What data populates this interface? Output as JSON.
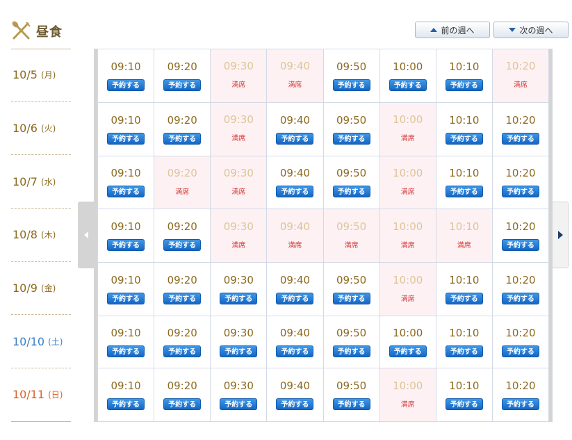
{
  "header": {
    "title": "昼食",
    "icon": "utensils-icon"
  },
  "nav": {
    "prev_label": "前の週へ",
    "next_label": "次の週へ"
  },
  "labels": {
    "reserve": "予約する",
    "full": "満席"
  },
  "colors": {
    "weekday": "#8b6a1f",
    "saturday": "#3b82c4",
    "sunday": "#d9622a",
    "reserve_button": "#1e7ad6",
    "full_text": "#d43a3a",
    "full_bg": "#fdf1f3"
  },
  "times": [
    "09:10",
    "09:20",
    "09:30",
    "09:40",
    "09:50",
    "10:00",
    "10:10",
    "10:20"
  ],
  "days": [
    {
      "date": "10/5",
      "weekday": "(月)",
      "type": "weekday",
      "full": [
        2,
        3,
        7
      ]
    },
    {
      "date": "10/6",
      "weekday": "(火)",
      "type": "weekday",
      "full": [
        2,
        5
      ]
    },
    {
      "date": "10/7",
      "weekday": "(水)",
      "type": "weekday",
      "full": [
        1,
        2,
        5
      ]
    },
    {
      "date": "10/8",
      "weekday": "(木)",
      "type": "weekday",
      "full": [
        2,
        3,
        4,
        5,
        6
      ]
    },
    {
      "date": "10/9",
      "weekday": "(金)",
      "type": "weekday",
      "full": [
        5
      ]
    },
    {
      "date": "10/10",
      "weekday": "(土)",
      "type": "sat",
      "full": []
    },
    {
      "date": "10/11",
      "weekday": "(日)",
      "type": "sun",
      "full": [
        5
      ]
    }
  ]
}
